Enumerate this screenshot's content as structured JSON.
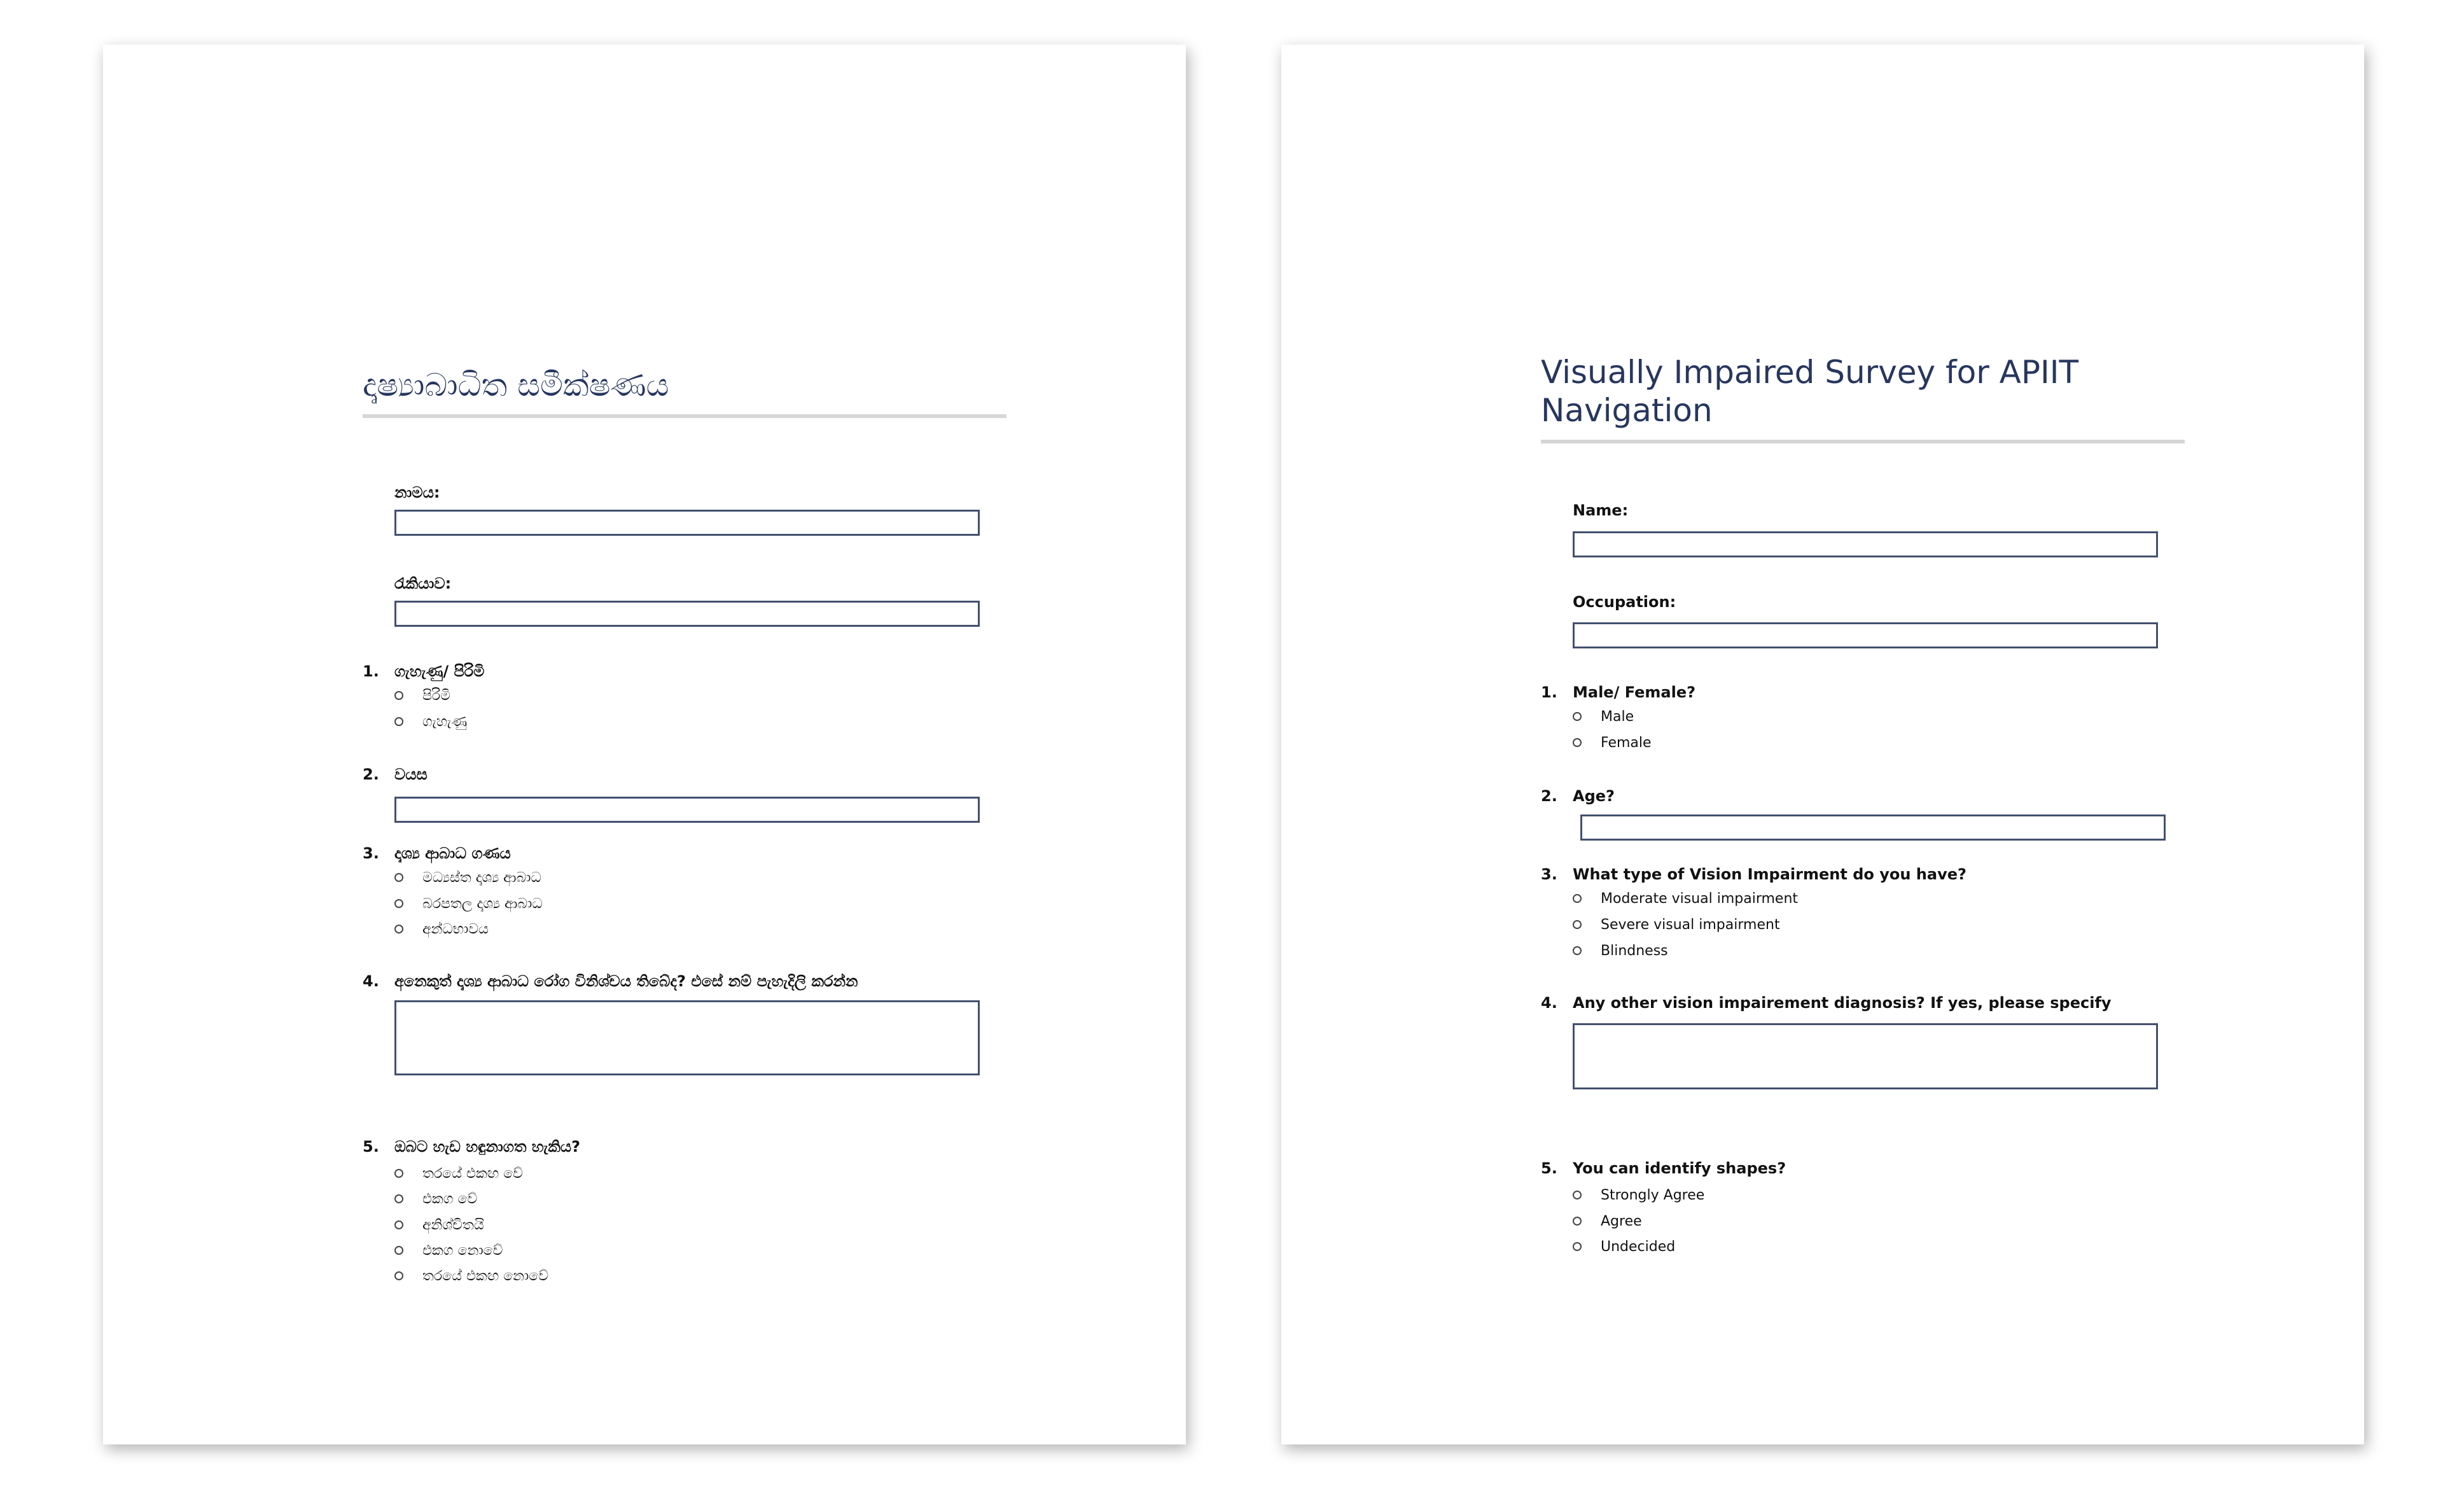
{
  "pages": [
    {
      "id": "sinhala",
      "title": "දෘෂ්‍යාබාධිත සමීක්ෂණය",
      "name_label": "නාමය:",
      "occupation_label": "රැකියාව:",
      "questions": [
        {
          "num": "1.",
          "text": "ගැහැණු/ පිරිමි",
          "options": [
            "පිරිමි",
            "ගැහැණු"
          ]
        },
        {
          "num": "2.",
          "text": " වයස"
        },
        {
          "num": "3.",
          "text": "දෘශ්‍ය ආබාධ ගණය",
          "options": [
            "මධ්‍යස්ත දෘශ්‍ය ආබාධ",
            "බරපතල දෘශ්‍ය ආබාධ",
            "අන්ධභාවය"
          ]
        },
        {
          "num": "4.",
          "text": "අනෙකුත් දෘශ්‍ය ආබාධ රෝග විනිශ්චය තිබේද? එසේ නම් පැහැදිලි කරන්න"
        },
        {
          "num": "5.",
          "text": "ඔබට හැඩ හඳුනාගත හැකිය?",
          "options": [
            "තරයේ එකඟ වේ",
            "එකග වේ",
            "අනිශ්චිතයි",
            "එකග නොවේ",
            "තරයේ එකඟ නොවේ"
          ]
        }
      ]
    },
    {
      "id": "english",
      "title": "Visually Impaired Survey for APIIT Navigation",
      "name_label": "Name:",
      "occupation_label": "Occupation:",
      "questions": [
        {
          "num": "1.",
          "text": "Male/ Female?",
          "options": [
            "Male",
            "Female"
          ]
        },
        {
          "num": "2.",
          "text": "Age?"
        },
        {
          "num": "3.",
          "text": "What type of Vision Impairment do you have?",
          "options": [
            "Moderate visual impairment",
            "Severe visual impairment",
            "Blindness"
          ]
        },
        {
          "num": "4.",
          "text": "Any other vision impairement diagnosis? If yes, please specify"
        },
        {
          "num": "5.",
          "text": "You can identify shapes?",
          "options": [
            "Strongly Agree",
            "Agree",
            "Undecided"
          ]
        }
      ]
    }
  ]
}
